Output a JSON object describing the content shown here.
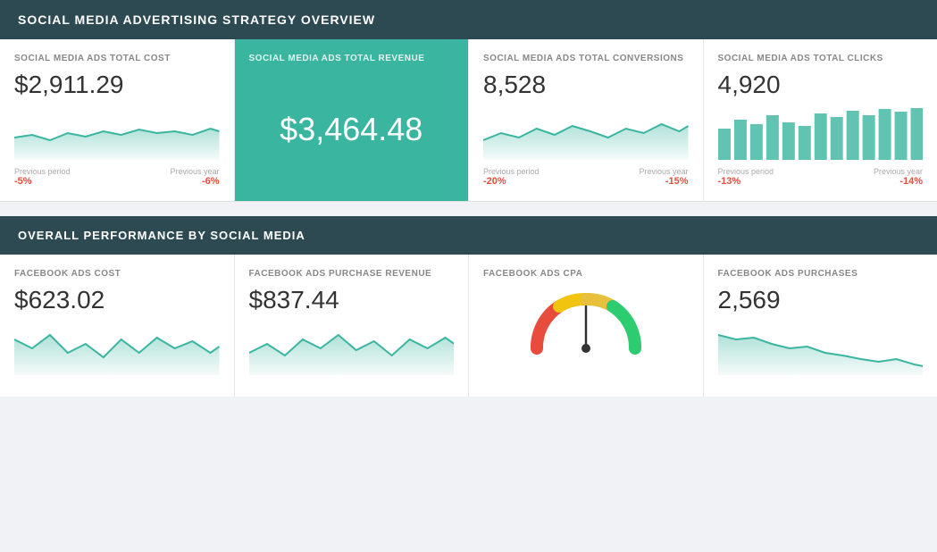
{
  "page": {
    "title": "SOCIAL MEDIA ADVERTISING STRATEGY OVERVIEW",
    "section2_title": "OVERALL PERFORMANCE BY SOCIAL MEDIA"
  },
  "top_cards": [
    {
      "id": "total-cost",
      "label": "SOCIAL MEDIA ADS TOTAL COST",
      "value": "$2,911.29",
      "highlighted": false,
      "prev_period_label": "Previous period",
      "prev_period_value": "-5%",
      "prev_period_negative": true,
      "prev_year_label": "Previous year",
      "prev_year_value": "-6%",
      "prev_year_negative": true,
      "chart_type": "line"
    },
    {
      "id": "total-revenue",
      "label": "SOCIAL MEDIA ADS TOTAL REVENUE",
      "value": "$3,464.48",
      "highlighted": true,
      "chart_type": "none"
    },
    {
      "id": "total-conversions",
      "label": "SOCIAL MEDIA ADS TOTAL CONVERSIONS",
      "value": "8,528",
      "highlighted": false,
      "prev_period_label": "Previous period",
      "prev_period_value": "-20%",
      "prev_period_negative": true,
      "prev_year_label": "Previous year",
      "prev_year_value": "-15%",
      "prev_year_negative": true,
      "chart_type": "line"
    },
    {
      "id": "total-clicks",
      "label": "SOCIAL MEDIA ADS TOTAL CLICKS",
      "value": "4,920",
      "highlighted": false,
      "prev_period_label": "Previous period",
      "prev_period_value": "-13%",
      "prev_period_negative": true,
      "prev_year_label": "Previous year",
      "prev_year_value": "-14%",
      "prev_year_negative": true,
      "chart_type": "bar"
    }
  ],
  "bottom_cards": [
    {
      "id": "fb-cost",
      "label": "FACEBOOK ADS COST",
      "value": "$623.02",
      "chart_type": "line"
    },
    {
      "id": "fb-revenue",
      "label": "FACEBOOK ADS PURCHASE REVENUE",
      "value": "$837.44",
      "chart_type": "line"
    },
    {
      "id": "fb-cpa",
      "label": "FACEBOOK ADS CPA",
      "value": "",
      "chart_type": "gauge"
    },
    {
      "id": "fb-purchases",
      "label": "FACEBOOK ADS PURCHASES",
      "value": "2,569",
      "chart_type": "line_down"
    }
  ]
}
